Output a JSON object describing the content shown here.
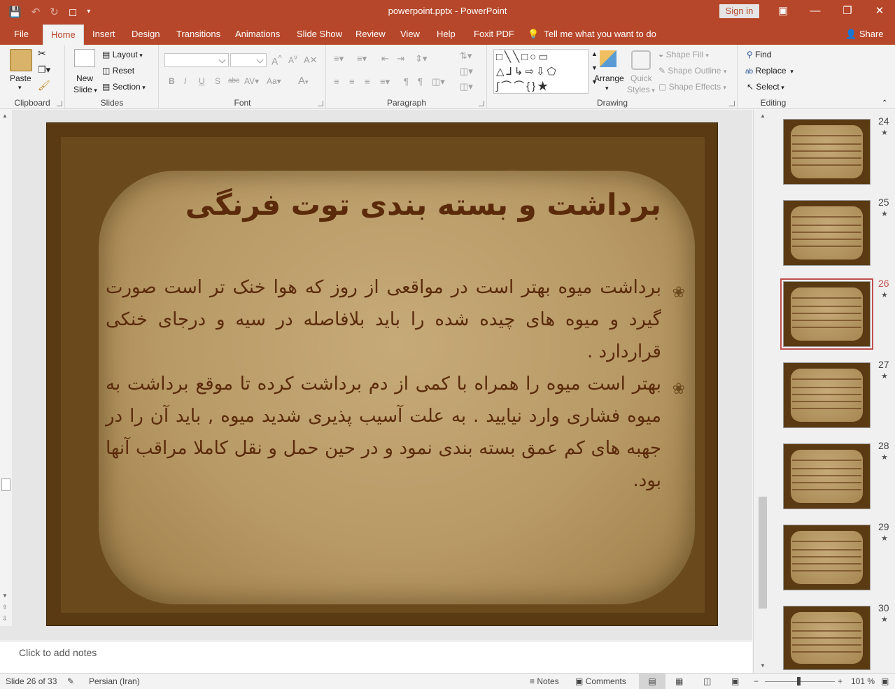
{
  "window": {
    "doc_title": "powerpoint.pptx  -  PowerPoint",
    "sign_in": "Sign in"
  },
  "tabs": [
    "File",
    "Home",
    "Insert",
    "Design",
    "Transitions",
    "Animations",
    "Slide Show",
    "Review",
    "View",
    "Help",
    "Foxit PDF"
  ],
  "tell_me": "Tell me what you want to do",
  "share": "Share",
  "ribbon": {
    "clipboard": {
      "label": "Clipboard",
      "paste": "Paste"
    },
    "slides": {
      "label": "Slides",
      "new_slide_1": "New",
      "new_slide_2": "Slide",
      "layout": "Layout",
      "reset": "Reset",
      "section": "Section"
    },
    "font": {
      "label": "Font"
    },
    "paragraph": {
      "label": "Paragraph"
    },
    "drawing": {
      "label": "Drawing",
      "arrange": "Arrange",
      "quick_styles_1": "Quick",
      "quick_styles_2": "Styles",
      "shape_fill": "Shape Fill",
      "shape_outline": "Shape Outline",
      "shape_effects": "Shape Effects"
    },
    "editing": {
      "label": "Editing",
      "find": "Find",
      "replace": "Replace",
      "select": "Select"
    }
  },
  "slide": {
    "title": "برداشت و بسته بندی توت فرنگی",
    "bullets": [
      "برداشت میوه بهتر است در مواقعی از روز که هوا خنک تر است صورت گیرد و میوه های چیده شده را باید بلافاصله در سیه و درجای خنکی قراردارد .",
      "بهتر است میوه را همراه با کمی از دم برداشت کرده تا موقع برداشت به میوه فشاری وارد نیایید . به علت آسیب پذیری شدید میوه , باید آن را در جهبه های کم عمق بسته بندی نمود و در حین حمل و نقل کاملا مراقب آنها بود."
    ]
  },
  "notes_placeholder": "Click to add notes",
  "thumbnails": [
    {
      "num": "24",
      "star": "★"
    },
    {
      "num": "25",
      "star": "★"
    },
    {
      "num": "26",
      "star": "★"
    },
    {
      "num": "27",
      "star": "★"
    },
    {
      "num": "28",
      "star": "★"
    },
    {
      "num": "29",
      "star": "★"
    },
    {
      "num": "30",
      "star": "★"
    }
  ],
  "status": {
    "slide_info": "Slide 26 of 33",
    "language": "Persian (Iran)",
    "notes": "Notes",
    "comments": "Comments",
    "zoom": "101 %"
  },
  "colors": {
    "accent": "#b7472a",
    "selection": "#c0504d"
  }
}
